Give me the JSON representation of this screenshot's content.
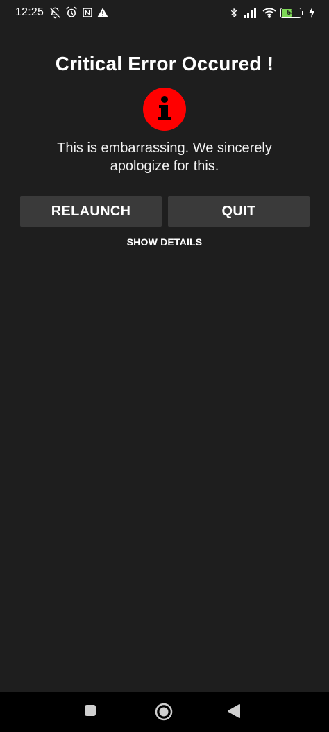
{
  "status_bar": {
    "time": "12:25",
    "battery_level": "58",
    "battery_percent": 58,
    "icons_left": [
      "bell-off-icon",
      "alarm-icon",
      "nfc-icon",
      "warning-icon"
    ],
    "icons_right": [
      "bluetooth-icon",
      "signal-icon",
      "wifi-icon",
      "battery-icon",
      "charging-icon"
    ]
  },
  "dialog": {
    "title": "Critical Error Occured !",
    "icon": "info-icon",
    "icon_color": "#ff0000",
    "message": "This is embarrassing. We sincerely apologize for this.",
    "relaunch_label": "RELAUNCH",
    "quit_label": "QUIT",
    "details_label": "SHOW DETAILS"
  },
  "nav_bar": {
    "buttons": [
      "recents-icon",
      "home-icon",
      "back-icon"
    ]
  },
  "colors": {
    "background": "#1e1e1e",
    "button": "#3a3a3a",
    "battery": "#7ed957",
    "error": "#ff0000"
  }
}
